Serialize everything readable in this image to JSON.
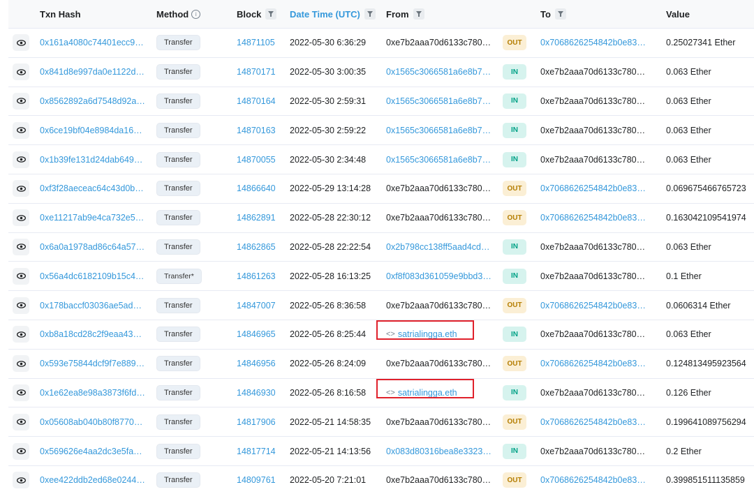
{
  "headers": {
    "txn_hash": "Txn Hash",
    "method": "Method",
    "method_info": "i",
    "block": "Block",
    "datetime": "Date Time (UTC)",
    "from": "From",
    "to": "To",
    "value": "Value"
  },
  "icons": {
    "eye": "eye-icon",
    "filter": "funnel-icon",
    "contract": "code-brackets-icon"
  },
  "colors": {
    "link": "#3498db",
    "out_bg": "#fbefd5",
    "out_text": "#b47d00",
    "in_bg": "#d6f3ee",
    "in_text": "#00a186",
    "highlight": "#e0212b"
  },
  "rows": [
    {
      "hash": "0x161a4080c74401ecc9…",
      "method": "Transfer",
      "block": "14871105",
      "datetime": "2022-05-30 6:36:29",
      "from": "0xe7b2aaa70d6133c780…",
      "dir": "OUT",
      "to": "0x7068626254842b0e83…",
      "value": "0.25027341 Ether"
    },
    {
      "hash": "0x841d8e997da0e1122d…",
      "method": "Transfer",
      "block": "14870171",
      "datetime": "2022-05-30 3:00:35",
      "from": "0x1565c3066581a6e8b7…",
      "dir": "IN",
      "to": "0xe7b2aaa70d6133c780…",
      "value": "0.063 Ether"
    },
    {
      "hash": "0x8562892a6d7548d92a…",
      "method": "Transfer",
      "block": "14870164",
      "datetime": "2022-05-30 2:59:31",
      "from": "0x1565c3066581a6e8b7…",
      "dir": "IN",
      "to": "0xe7b2aaa70d6133c780…",
      "value": "0.063 Ether"
    },
    {
      "hash": "0x6ce19bf04e8984da16…",
      "method": "Transfer",
      "block": "14870163",
      "datetime": "2022-05-30 2:59:22",
      "from": "0x1565c3066581a6e8b7…",
      "dir": "IN",
      "to": "0xe7b2aaa70d6133c780…",
      "value": "0.063 Ether"
    },
    {
      "hash": "0x1b39fe131d24dab649…",
      "method": "Transfer",
      "block": "14870055",
      "datetime": "2022-05-30 2:34:48",
      "from": "0x1565c3066581a6e8b7…",
      "dir": "IN",
      "to": "0xe7b2aaa70d6133c780…",
      "value": "0.063 Ether"
    },
    {
      "hash": "0xf3f28aeceac64c43d0b…",
      "method": "Transfer",
      "block": "14866640",
      "datetime": "2022-05-29 13:14:28",
      "from": "0xe7b2aaa70d6133c780…",
      "dir": "OUT",
      "to": "0x7068626254842b0e83…",
      "value": "0.069675466765723"
    },
    {
      "hash": "0xe11217ab9e4ca732e5…",
      "method": "Transfer",
      "block": "14862891",
      "datetime": "2022-05-28 22:30:12",
      "from": "0xe7b2aaa70d6133c780…",
      "dir": "OUT",
      "to": "0x7068626254842b0e83…",
      "value": "0.163042109541974"
    },
    {
      "hash": "0x6a0a1978ad86c64a57…",
      "method": "Transfer",
      "block": "14862865",
      "datetime": "2022-05-28 22:22:54",
      "from": "0x2b798cc138ff5aad4cd…",
      "dir": "IN",
      "to": "0xe7b2aaa70d6133c780…",
      "value": "0.063 Ether"
    },
    {
      "hash": "0x56a4dc6182109b15c4…",
      "method": "Transfer*",
      "block": "14861263",
      "datetime": "2022-05-28 16:13:25",
      "from": "0xf8f083d361059e9bbd3…",
      "dir": "IN",
      "to": "0xe7b2aaa70d6133c780…",
      "value": "0.1 Ether"
    },
    {
      "hash": "0x178baccf03036ae5ad…",
      "method": "Transfer",
      "block": "14847007",
      "datetime": "2022-05-26 8:36:58",
      "from": "0xe7b2aaa70d6133c780…",
      "dir": "OUT",
      "to": "0x7068626254842b0e83…",
      "value": "0.0606314 Ether"
    },
    {
      "hash": "0xb8a18cd28c2f9eaa43…",
      "method": "Transfer",
      "block": "14846965",
      "datetime": "2022-05-26 8:25:44",
      "from": "satrialingga.eth",
      "from_is_ens": true,
      "dir": "IN",
      "to": "0xe7b2aaa70d6133c780…",
      "value": "0.063 Ether"
    },
    {
      "hash": "0x593e75844dcf9f7e889…",
      "method": "Transfer",
      "block": "14846956",
      "datetime": "2022-05-26 8:24:09",
      "from": "0xe7b2aaa70d6133c780…",
      "dir": "OUT",
      "to": "0x7068626254842b0e83…",
      "value": "0.124813495923564"
    },
    {
      "hash": "0x1e62ea8e98a3873f6fd…",
      "method": "Transfer",
      "block": "14846930",
      "datetime": "2022-05-26 8:16:58",
      "from": "satrialingga.eth",
      "from_is_ens": true,
      "dir": "IN",
      "to": "0xe7b2aaa70d6133c780…",
      "value": "0.126 Ether"
    },
    {
      "hash": "0x05608ab040b80f8770…",
      "method": "Transfer",
      "block": "14817906",
      "datetime": "2022-05-21 14:58:35",
      "from": "0xe7b2aaa70d6133c780…",
      "dir": "OUT",
      "to": "0x7068626254842b0e83…",
      "value": "0.199641089756294"
    },
    {
      "hash": "0x569626e4aa2dc3e5fa…",
      "method": "Transfer",
      "block": "14817714",
      "datetime": "2022-05-21 14:13:56",
      "from": "0x083d80316bea8e3323…",
      "dir": "IN",
      "to": "0xe7b2aaa70d6133c780…",
      "value": "0.2 Ether"
    },
    {
      "hash": "0xee422ddb2ed68e0244…",
      "method": "Transfer",
      "block": "14809761",
      "datetime": "2022-05-20 7:21:01",
      "from": "0xe7b2aaa70d6133c780…",
      "dir": "OUT",
      "to": "0x7068626254842b0e83…",
      "value": "0.399851511135859"
    }
  ]
}
